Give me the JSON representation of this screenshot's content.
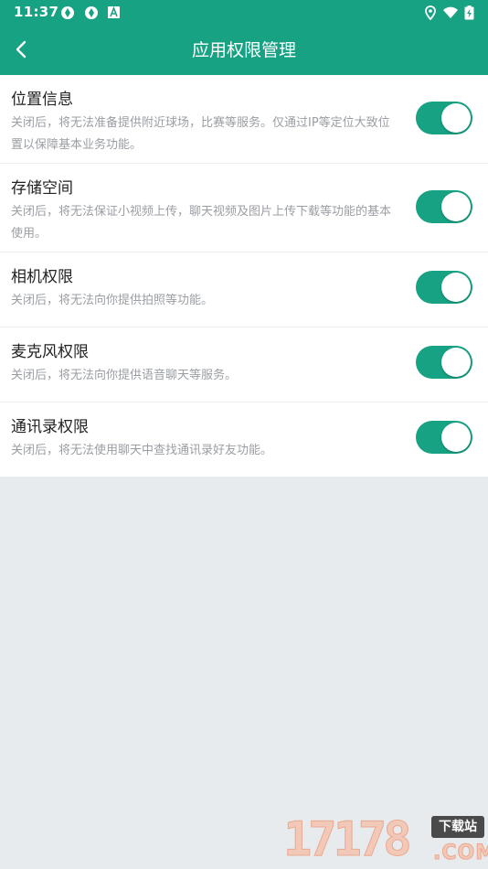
{
  "status_bar": {
    "time": "11:37",
    "icons_left": [
      "sync-icon",
      "sync-icon",
      "app-a-icon"
    ],
    "icons_right": [
      "location-icon",
      "wifi-icon",
      "battery-charging-icon"
    ]
  },
  "app_bar": {
    "back_icon": "chevron-left-icon",
    "title": "应用权限管理"
  },
  "colors": {
    "accent": "#16a283",
    "background": "#e8ebee",
    "toggle_on": "#16a283"
  },
  "permissions": [
    {
      "title": "位置信息",
      "description": "关闭后，将无法准备提供附近球场，比赛等服务。仅通过IP等定位大致位置以保障基本业务功能。",
      "enabled": true
    },
    {
      "title": "存储空间",
      "description": "关闭后，将无法保证小视频上传，聊天视频及图片上传下载等功能的基本使用。",
      "enabled": true
    },
    {
      "title": "相机权限",
      "description": "关闭后，将无法向你提供拍照等功能。",
      "enabled": true
    },
    {
      "title": "麦克风权限",
      "description": "关闭后，将无法向你提供语音聊天等服务。",
      "enabled": true
    },
    {
      "title": "通讯录权限",
      "description": "关闭后，将无法使用聊天中查找通讯录好友功能。",
      "enabled": true
    }
  ],
  "watermark": {
    "number": "17178",
    "tag": "下载站",
    "domain": ".COM"
  }
}
